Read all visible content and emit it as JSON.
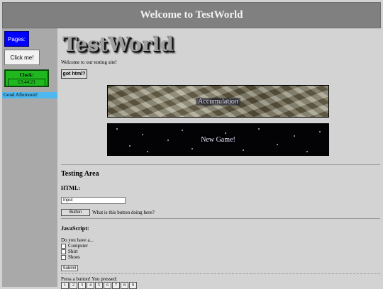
{
  "header": {
    "title": "Welcome to TestWorld"
  },
  "sidebar": {
    "pages_label": "Pages:",
    "click_label": "Click me!",
    "clock_label": "Clock:",
    "clock_time": "13:44:21",
    "greeting": "Good Afternoon!"
  },
  "main": {
    "logo": "TestWorld",
    "welcome": "Welcome to our testing site!",
    "got_html_label": "got html?",
    "banner1_label": "Accumulation",
    "banner2_label": "New Game!",
    "testing_heading": "Testing Area",
    "html_heading": "HTML:",
    "input_value": "Input",
    "button_label": "Button",
    "button_note": "What is this button doing here?",
    "js_heading": "JavaScript:",
    "question": "Do you have a...",
    "options": [
      "Computer",
      "Shirt",
      "Shoes"
    ],
    "submit_label": "Submit",
    "press_text": "Press a button! You pressed:",
    "number_buttons": [
      "1",
      "2",
      "3",
      "4",
      "5",
      "6",
      "7",
      "8",
      "9"
    ]
  },
  "colors": {
    "header_bg": "#808080",
    "sidebar_bg": "#a9a9a9",
    "page_bg": "#d3d3d3",
    "pages_button": "#0000ff",
    "clock_bg": "#1fb81f",
    "greeting_bg": "#4db8f0"
  }
}
